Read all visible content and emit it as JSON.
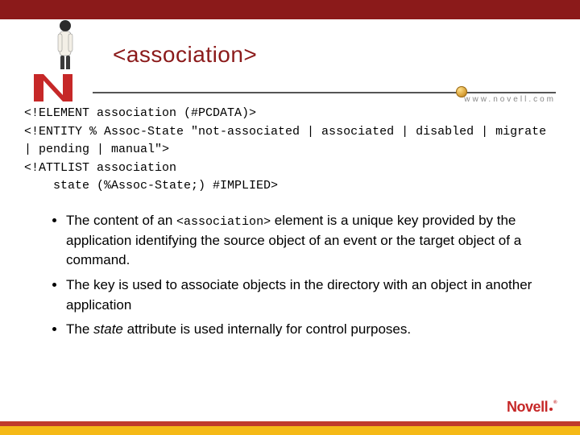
{
  "header": {
    "title": "<association>",
    "url": "www.novell.com"
  },
  "code": {
    "l1": "<!ELEMENT association (#PCDATA)>",
    "l2": "<!ENTITY % Assoc-State \"not-associated | associated | disabled | migrate | pending | manual\">",
    "l3": "<!ATTLIST association",
    "l4": "    state (%Assoc-State;) #IMPLIED>"
  },
  "bullets": {
    "b1_pre": "The content of an ",
    "b1_code": "<association>",
    "b1_post": " element is a unique key provided by the application identifying the source object of an event or the target object of a command.",
    "b2": "The key is used to associate objects in the directory with an object in another application",
    "b3_pre": "The ",
    "b3_em": "state",
    "b3_post": " attribute is used internally for control purposes."
  },
  "footer": {
    "brand": "Novell"
  }
}
